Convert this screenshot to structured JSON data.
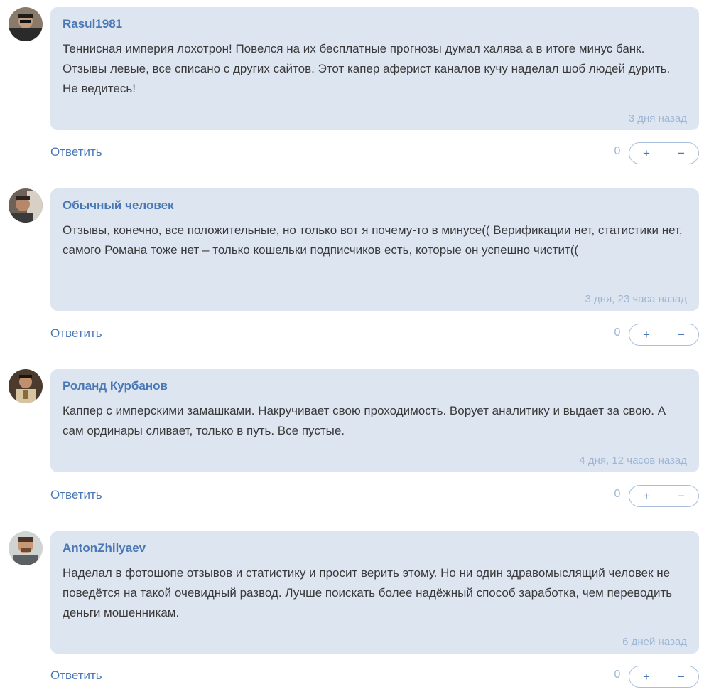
{
  "comments": [
    {
      "author": "Rasul1981",
      "text": "Теннисная империя лохотрон! Повелся на их бесплатные прогнозы думал халява а в итоге минус банк. Отзывы левые, все списано с других сайтов. Этот капер аферист каналов кучу наделал шоб людей дурить. Не ведитесь!",
      "time": "3 дня назад",
      "reply_label": "Ответить",
      "score": "0",
      "plus": "+",
      "minus": "−"
    },
    {
      "author": "Обычный человек",
      "text": "Отзывы, конечно, все положительные, но только вот я почему-то в минусе(( Верификации нет, статистики нет, самого Романа тоже нет – только кошельки подписчиков есть, которые он успешно чистит((",
      "time": "3 дня, 23 часа назад",
      "reply_label": "Ответить",
      "score": "0",
      "plus": "+",
      "minus": "−"
    },
    {
      "author": "Роланд Курбанов",
      "text": "Каппер с имперскими замашками. Накручивает свою проходимость. Ворует аналитику и выдает за свою. А сам ординары сливает, только в путь. Все пустые.",
      "time": "4 дня, 12 часов назад",
      "reply_label": "Ответить",
      "score": "0",
      "plus": "+",
      "minus": "−"
    },
    {
      "author": "AntonZhilyaev",
      "text": "Наделал в фотошопе отзывов и статистику и просит верить этому. Но ни один здравомыслящий человек не поведётся на такой очевидный развод. Лучше поискать более надёжный способ заработка, чем переводить деньги мошенникам.",
      "time": "6 дней назад",
      "reply_label": "Ответить",
      "score": "0",
      "plus": "+",
      "minus": "−"
    }
  ]
}
